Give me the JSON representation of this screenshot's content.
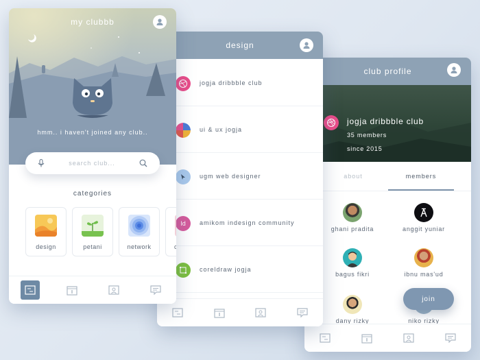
{
  "home": {
    "title": "my clubbb",
    "empty_text": "hmm.. i haven't joined any club..",
    "search_placeholder": "search club...",
    "categories_title": "categories",
    "categories": [
      {
        "label": "design",
        "icon": "landscape-icon"
      },
      {
        "label": "petani",
        "icon": "plant-icon"
      },
      {
        "label": "network",
        "icon": "signal-icon"
      },
      {
        "label": "c",
        "icon": "partial-icon"
      }
    ]
  },
  "design": {
    "title": "design",
    "clubs": [
      {
        "name": "jogja dribbble club",
        "icon": "dribbble-icon",
        "color": "#ea4c89"
      },
      {
        "name": "ui & ux jogja",
        "icon": "ui-ux-icon",
        "color": "#5b7bd5"
      },
      {
        "name": "ugm web designer",
        "icon": "cursor-icon",
        "color": "#9bbfe6"
      },
      {
        "name": "amikom indesign community",
        "icon": "indesign-icon",
        "color": "#d65a9c",
        "icon_text": "Id"
      },
      {
        "name": "coreldraw jogja",
        "icon": "coreldraw-icon",
        "color": "#7cbf3f"
      }
    ]
  },
  "profile": {
    "title": "club profile",
    "club_name": "jogja dribbble club",
    "members_count": "35 members",
    "since": "since 2015",
    "tabs": [
      "about",
      "members"
    ],
    "active_tab": "members",
    "members": [
      {
        "name": "ghani pradita",
        "icon": "avatar-photo-icon"
      },
      {
        "name": "anggit yuniar",
        "icon": "avatar-logo-icon"
      },
      {
        "name": "bagus fikri",
        "icon": "avatar-cartoon-icon"
      },
      {
        "name": "ibnu mas'ud",
        "icon": "avatar-photo-icon"
      },
      {
        "name": "dany rizky",
        "icon": "avatar-photo-icon"
      },
      {
        "name": "niko rizky",
        "icon": "avatar-photo-icon"
      }
    ],
    "join_label": "join"
  },
  "colors": {
    "header": "#8ea2b5",
    "accent": "#6e8aa5",
    "dribbble": "#ea4c89"
  }
}
